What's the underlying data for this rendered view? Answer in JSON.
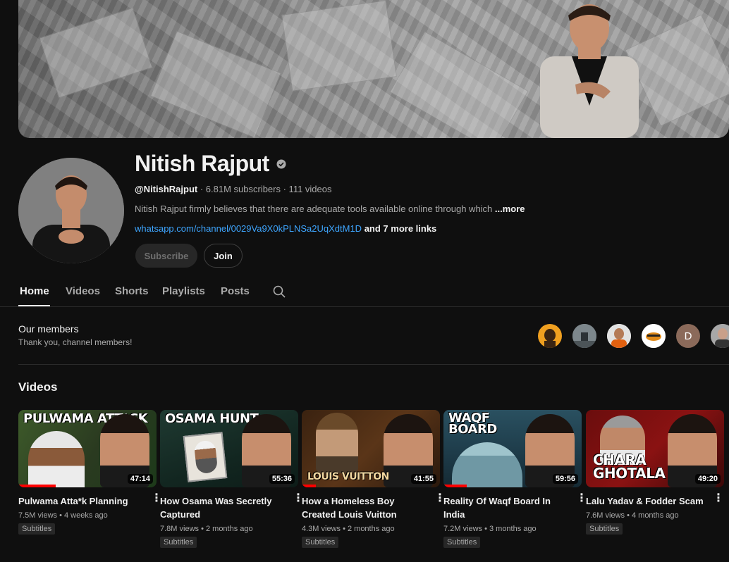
{
  "channel": {
    "name": "Nitish Rajput",
    "handle": "@NitishRajput",
    "stats": " · 6.81M subscribers · 111 videos",
    "description": "Nitish Rajput firmly believes that there are adequate tools available online through which ",
    "more_label": "...more",
    "link": "whatsapp.com/channel/0029Va9X0kPLNSa2UqXdtM1D",
    "more_links": " and 7 more links"
  },
  "buttons": {
    "subscribe": "Subscribe",
    "join": "Join"
  },
  "tabs": [
    "Home",
    "Videos",
    "Shorts",
    "Playlists",
    "Posts"
  ],
  "members": {
    "title": "Our members",
    "subtitle": "Thank you, channel members!",
    "avatar_letter": "D"
  },
  "videos": {
    "heading": "Videos",
    "items": [
      {
        "thumb_text": "PULWAMA ATT*CK",
        "duration": "47:14",
        "title": "Pulwama Atta*k Planning",
        "meta": "7.5M views • 4 weeks ago",
        "badge": "Subtitles",
        "progress": 27
      },
      {
        "thumb_text": "OSAMA HUNT",
        "duration": "55:36",
        "title": "How Osama Was Secretly Captured",
        "meta": "7.8M views • 2 months ago",
        "badge": "Subtitles",
        "progress": 0
      },
      {
        "thumb_text": "LOUIS VUITTON",
        "duration": "41:55",
        "title": "How a Homeless Boy Created Louis Vuitton",
        "meta": "4.3M views • 2 months ago",
        "badge": "Subtitles",
        "progress": 10
      },
      {
        "thumb_text": "WAQF BOARD",
        "duration": "59:56",
        "title": "Reality Of Waqf Board In India",
        "meta": "7.2M views • 3 months ago",
        "badge": "Subtitles",
        "progress": 17
      },
      {
        "thumb_text": "CHARA GHOTALA",
        "duration": "49:20",
        "title": "Lalu Yadav & Fodder Scam",
        "meta": "7.6M views • 4 months ago",
        "badge": "Subtitles",
        "progress": 0
      }
    ]
  },
  "colors": {
    "accent_link": "#3ea6ff",
    "progress": "#ff0000",
    "background": "#0f0f0f"
  },
  "icons": {
    "verified": "verified-check-icon",
    "search": "search-icon",
    "more": "kebab-menu-icon"
  }
}
